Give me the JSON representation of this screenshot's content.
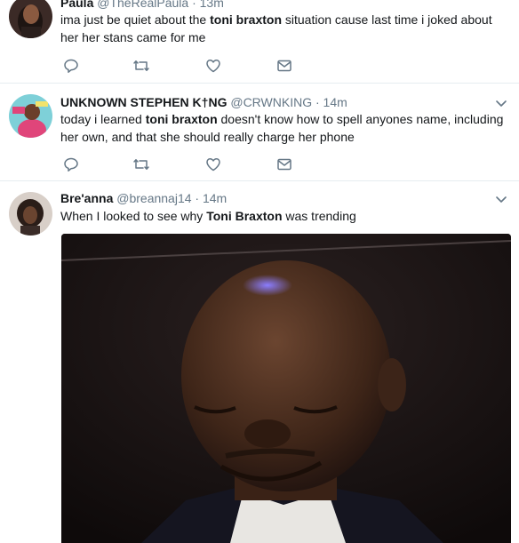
{
  "tweets": [
    {
      "name": "Paula",
      "handle": "@TheRealPaula",
      "dot": "·",
      "time": "13m",
      "text_parts": [
        "ima just be quiet about the ",
        "toni braxton",
        " situation cause last time i joked about her her stans came for me"
      ]
    },
    {
      "name": "UNKNOWN STEPHEN K†NG",
      "handle": "@CRWNKING",
      "dot": "·",
      "time": "14m",
      "text_parts": [
        "today i learned ",
        "toni braxton",
        " doesn't know how to spell anyones name, including her own, and that she should really charge her phone"
      ]
    },
    {
      "name": "Bre'anna",
      "handle": "@breannaj14",
      "dot": "·",
      "time": "14m",
      "text_parts": [
        "When I looked to see why ",
        "Toni Braxton",
        " was trending"
      ]
    }
  ],
  "icons": {
    "reply": "reply-icon",
    "retweet": "retweet-icon",
    "like": "heart-icon",
    "message": "envelope-icon",
    "more": "chevron-down-icon"
  },
  "colors": {
    "icon": "#657786",
    "divider": "#e6ecf0",
    "text": "#14171a",
    "secondary": "#657786"
  }
}
